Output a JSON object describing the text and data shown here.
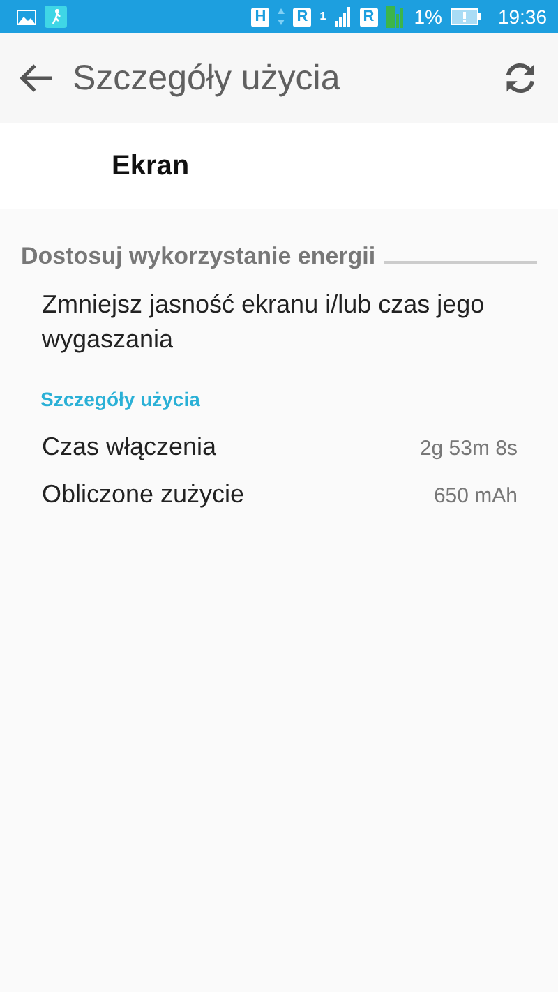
{
  "status_bar": {
    "network_badge": "H",
    "roaming_badges": [
      "R",
      "R"
    ],
    "sim_number": "1",
    "battery": "1%",
    "time": "19:36"
  },
  "toolbar": {
    "title": "Szczegóły użycia"
  },
  "header": {
    "title": "Ekran"
  },
  "section": {
    "title": "Dostosuj wykorzystanie energii",
    "suggestion": "Zmniejsz jasność ekranu i/lub czas jego wygaszania"
  },
  "details": {
    "title": "Szczegóły użycia",
    "rows": [
      {
        "label": "Czas włączenia",
        "value": "2g 53m 8s"
      },
      {
        "label": "Obliczone zużycie",
        "value": "650 mAh"
      }
    ]
  }
}
